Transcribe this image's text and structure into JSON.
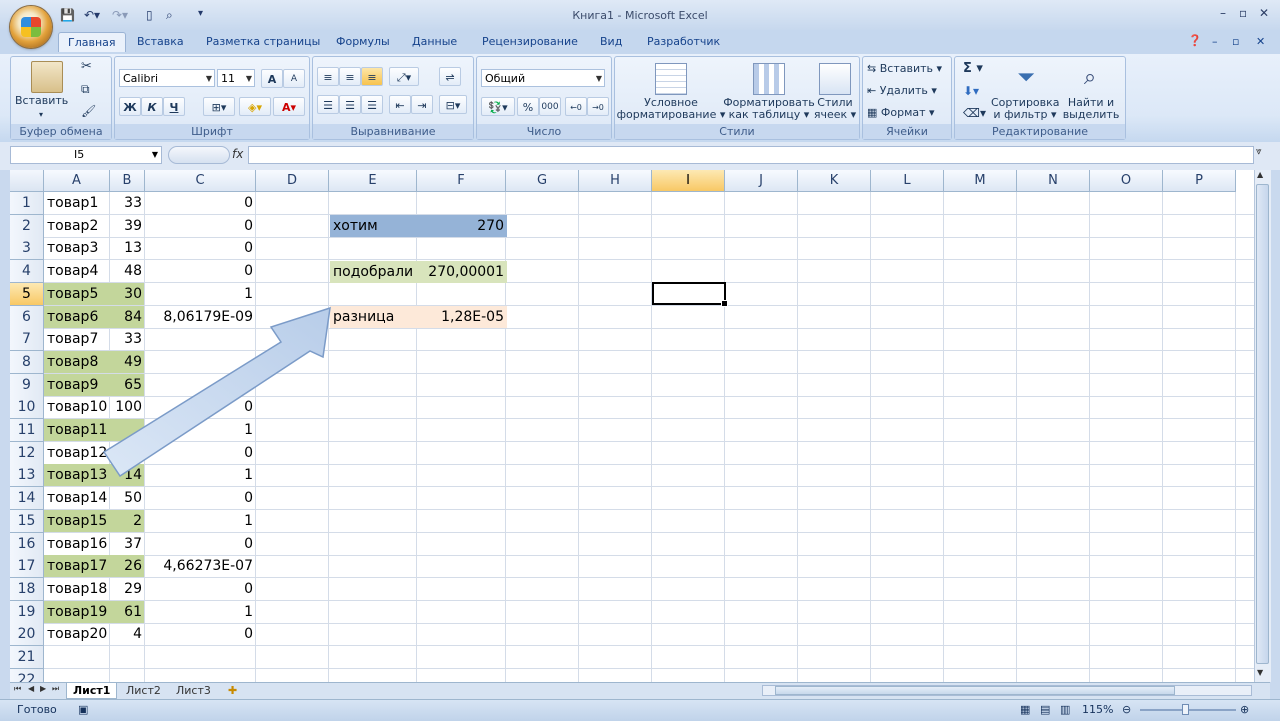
{
  "window": {
    "title": "Книга1 - Microsoft Excel"
  },
  "ribbon_tabs": [
    "Главная",
    "Вставка",
    "Разметка страницы",
    "Формулы",
    "Данные",
    "Рецензирование",
    "Вид",
    "Разработчик"
  ],
  "ribbon": {
    "clipboard": {
      "label": "Буфер обмена",
      "paste": "Вставить"
    },
    "font": {
      "label": "Шрифт",
      "font_name": "Calibri",
      "font_size": "11",
      "bold": "Ж",
      "italic": "К",
      "underline": "Ч",
      "grow": "A",
      "shrink": "A"
    },
    "alignment": {
      "label": "Выравнивание"
    },
    "number": {
      "label": "Число",
      "format": "Общий",
      "percent": "%",
      "thousands": "000"
    },
    "styles": {
      "label": "Стили",
      "conditional": "Условное",
      "conditional2": "форматирование",
      "as_table": "Форматировать",
      "as_table2": "как таблицу",
      "cell_styles": "Стили",
      "cell_styles2": "ячеек"
    },
    "cells": {
      "label": "Ячейки",
      "insert": "Вставить",
      "delete": "Удалить",
      "format": "Формат"
    },
    "editing": {
      "label": "Редактирование",
      "sort": "Сортировка",
      "sort2": "и фильтр",
      "find": "Найти и",
      "find2": "выделить",
      "sigma": "Σ"
    }
  },
  "formula_bar": {
    "name_box": "I5",
    "fx": "fx",
    "formula": ""
  },
  "columns": [
    "A",
    "B",
    "C",
    "D",
    "E",
    "F",
    "G",
    "H",
    "I",
    "J",
    "K",
    "L",
    "M",
    "N",
    "O",
    "P"
  ],
  "selected_column": "I",
  "selected_row": 5,
  "rows": [
    {
      "n": "1",
      "a": "товар1",
      "b": "33",
      "c": "0",
      "hl": false
    },
    {
      "n": "2",
      "a": "товар2",
      "b": "39",
      "c": "0",
      "hl": false
    },
    {
      "n": "3",
      "a": "товар3",
      "b": "13",
      "c": "0",
      "hl": false
    },
    {
      "n": "4",
      "a": "товар4",
      "b": "48",
      "c": "0",
      "hl": false
    },
    {
      "n": "5",
      "a": "товар5",
      "b": "30",
      "c": "1",
      "hl": true
    },
    {
      "n": "6",
      "a": "товар6",
      "b": "84",
      "c": "8,06179E-09",
      "hl": true
    },
    {
      "n": "7",
      "a": "товар7",
      "b": "33",
      "c": "",
      "hl": false
    },
    {
      "n": "8",
      "a": "товар8",
      "b": "49",
      "c": "",
      "hl": true
    },
    {
      "n": "9",
      "a": "товар9",
      "b": "65",
      "c": "1",
      "hl": true
    },
    {
      "n": "10",
      "a": "товар10",
      "b": "100",
      "c": "0",
      "hl": false
    },
    {
      "n": "11",
      "a": "товар11",
      "b": "",
      "c": "1",
      "hl": true
    },
    {
      "n": "12",
      "a": "товар12",
      "b": "",
      "c": "0",
      "hl": false
    },
    {
      "n": "13",
      "a": "товар13",
      "b": "14",
      "c": "1",
      "hl": true
    },
    {
      "n": "14",
      "a": "товар14",
      "b": "50",
      "c": "0",
      "hl": false
    },
    {
      "n": "15",
      "a": "товар15",
      "b": "2",
      "c": "1",
      "hl": true
    },
    {
      "n": "16",
      "a": "товар16",
      "b": "37",
      "c": "0",
      "hl": false
    },
    {
      "n": "17",
      "a": "товар17",
      "b": "26",
      "c": "4,66273E-07",
      "hl": true
    },
    {
      "n": "18",
      "a": "товар18",
      "b": "29",
      "c": "0",
      "hl": false
    },
    {
      "n": "19",
      "a": "товар19",
      "b": "61",
      "c": "1",
      "hl": true
    },
    {
      "n": "20",
      "a": "товар20",
      "b": "4",
      "c": "0",
      "hl": false
    },
    {
      "n": "21",
      "a": "",
      "b": "",
      "c": "",
      "hl": false
    },
    {
      "n": "22",
      "a": "",
      "b": "",
      "c": "",
      "hl": false
    }
  ],
  "summary": {
    "want_label": "хотим",
    "want_value": "270",
    "found_label": "подобрали",
    "found_value": "270,00001",
    "diff_label": "разница",
    "diff_value": "1,28E-05"
  },
  "sheets": [
    "Лист1",
    "Лист2",
    "Лист3"
  ],
  "status": {
    "ready": "Готово",
    "zoom": "115%"
  },
  "colors": {
    "highlight_green": "#c3d69b",
    "header_blue": "#95b3d7",
    "peach": "#fde9d9",
    "arrow": "#c6d9f1"
  }
}
